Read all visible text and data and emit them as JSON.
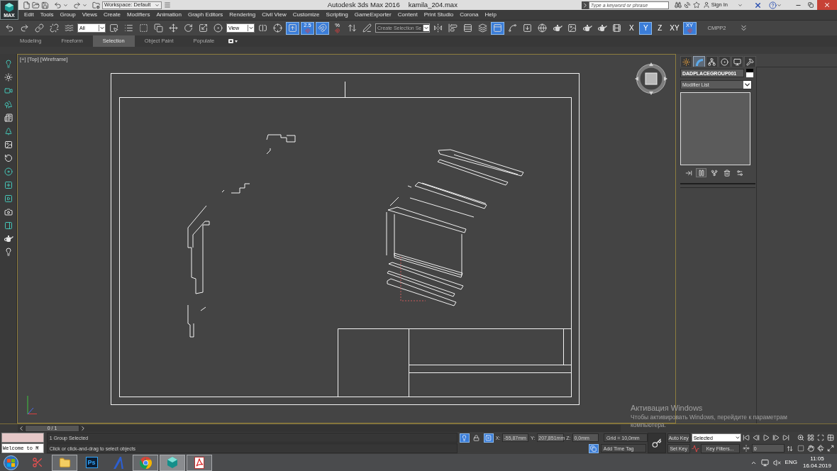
{
  "title_bar": {
    "workspace": "Workspace: Default",
    "app_name": "Autodesk 3ds Max 2016",
    "file_name": "kamila_204.max",
    "search": {
      "placeholder": "Type a keyword or phrase"
    },
    "sign_in": "Sign In"
  },
  "app_button": {
    "label": "MAX"
  },
  "menu_bar": [
    "Edit",
    "Tools",
    "Group",
    "Views",
    "Create",
    "Modifiers",
    "Animation",
    "Graph Editors",
    "Rendering",
    "Civil View",
    "Customize",
    "Scripting",
    "GameExporter",
    "Content",
    "Print Studio",
    "Corona",
    "Help"
  ],
  "main_toolbar": [
    {
      "kind": "undo",
      "on": false
    },
    {
      "kind": "redo",
      "on": false
    },
    {
      "kind": "link",
      "on": false
    },
    {
      "kind": "unlink",
      "on": false
    },
    {
      "kind": "bind",
      "on": false
    },
    {
      "kind": "dropdown",
      "value": "All",
      "disabled": false
    },
    {
      "kind": "select",
      "on": false
    },
    {
      "kind": "select_by_name",
      "on": false
    },
    {
      "kind": "region",
      "on": false
    },
    {
      "kind": "crossing",
      "on": false
    },
    {
      "kind": "move",
      "on": false
    },
    {
      "kind": "rotate",
      "on": false
    },
    {
      "kind": "scale",
      "on": false
    },
    {
      "kind": "place",
      "on": false
    },
    {
      "kind": "dropdown",
      "value": "View",
      "disabled": false
    },
    {
      "kind": "pivot",
      "on": false
    },
    {
      "kind": "manipulate",
      "on": false
    },
    {
      "kind": "shortcut",
      "on": true
    },
    {
      "kind": "snap",
      "label": "2.5",
      "on": true
    },
    {
      "kind": "angle_snap",
      "on": true
    },
    {
      "kind": "percent_snap",
      "label": "%",
      "on": false
    },
    {
      "kind": "spinner_snap",
      "on": false
    },
    {
      "kind": "named_sets",
      "on": false
    },
    {
      "kind": "dropdown",
      "value": "Create Selection Se",
      "disabled": true
    },
    {
      "kind": "mirror",
      "on": false
    },
    {
      "kind": "align",
      "on": false
    },
    {
      "kind": "explorer",
      "on": false
    },
    {
      "kind": "layers",
      "on": false
    },
    {
      "kind": "ribbon",
      "on": true
    },
    {
      "kind": "curve_editor",
      "on": false
    },
    {
      "kind": "schematic",
      "on": false
    },
    {
      "kind": "material",
      "on": false
    },
    {
      "kind": "render_setup",
      "on": false
    },
    {
      "kind": "frame_window",
      "on": false
    },
    {
      "kind": "render",
      "on": false
    },
    {
      "kind": "render_iterative",
      "on": false
    },
    {
      "kind": "a360",
      "on": false
    },
    {
      "kind": "axis",
      "label": "X",
      "on": false
    },
    {
      "kind": "axis",
      "label": "Y",
      "on": true
    },
    {
      "kind": "axis",
      "label": "Z",
      "on": false
    },
    {
      "kind": "axis",
      "label": "XY",
      "on": false
    },
    {
      "kind": "axis_snap",
      "label": "XY",
      "on": true
    },
    {
      "kind": "label",
      "label": "CMPP2"
    },
    {
      "kind": "more",
      "on": false
    }
  ],
  "ribbon_tabs": [
    {
      "label": "Modeling",
      "selected": false
    },
    {
      "label": "Freeform",
      "selected": false
    },
    {
      "label": "Selection",
      "selected": true
    },
    {
      "label": "Object Paint",
      "selected": false
    },
    {
      "label": "Populate",
      "selected": false
    }
  ],
  "viewport": {
    "labels": [
      "[+]",
      "[Top]",
      "[Wireframe]"
    ]
  },
  "command_panel": {
    "tabs": [
      {
        "kind": "create",
        "selected": false
      },
      {
        "kind": "modify",
        "selected": true
      },
      {
        "kind": "hierarchy",
        "selected": false
      },
      {
        "kind": "motion",
        "selected": false
      },
      {
        "kind": "display",
        "selected": false
      },
      {
        "kind": "utilities",
        "selected": false
      }
    ],
    "object_name": "DADPLACEGROUP001",
    "modifier_list": "Modifier List",
    "stack_tools": [
      {
        "kind": "pin",
        "on": false
      },
      {
        "kind": "show_end",
        "on": true
      },
      {
        "kind": "make_unique",
        "on": false
      },
      {
        "kind": "remove",
        "on": false
      },
      {
        "kind": "configure",
        "on": false
      }
    ]
  },
  "timeline": {
    "frame": "0 / 1",
    "level": 0
  },
  "status_bar": {
    "listener": {
      "output": "Welcome to M"
    },
    "messages": [
      "1 Group Selected",
      "Click or click-and-drag to select objects"
    ],
    "isolate": {
      "on": true
    },
    "lock": {
      "on": false
    },
    "offset_mode": {
      "on": true
    },
    "coordinates": [
      {
        "axis": "X:",
        "value": "-55,87mm"
      },
      {
        "axis": "Y:",
        "value": "207,851mm"
      },
      {
        "axis": "Z:",
        "value": "0,0mm"
      }
    ],
    "grid": "Grid = 10,0mm",
    "time_tag": {
      "label": "Add Time Tag",
      "on": true
    },
    "auto_key": {
      "label": "Auto Key",
      "on": false
    },
    "set_key": {
      "label": "Set Key",
      "on": false
    },
    "key_set": "Selected",
    "key_filters": "Key Filters...",
    "frame": "0"
  },
  "taskbar": {
    "apps": [
      {
        "kind": "scissors",
        "running": false,
        "selected": false
      },
      {
        "kind": "folder",
        "running": true,
        "selected": false
      },
      {
        "kind": "ps",
        "label": "Ps",
        "running": false,
        "selected": false
      },
      {
        "kind": "arch",
        "running": false,
        "selected": false
      },
      {
        "kind": "browser",
        "running": true,
        "selected": false
      },
      {
        "kind": "max",
        "running": true,
        "selected": true
      },
      {
        "kind": "pdf",
        "running": true,
        "selected": false
      }
    ],
    "language": "ENG",
    "time": "11:05",
    "date": "16.04.2019"
  },
  "activation_notice": {
    "title": "Активация Windows",
    "text": "Чтобы активировать Windows, перейдите к параметрам компьютера."
  }
}
